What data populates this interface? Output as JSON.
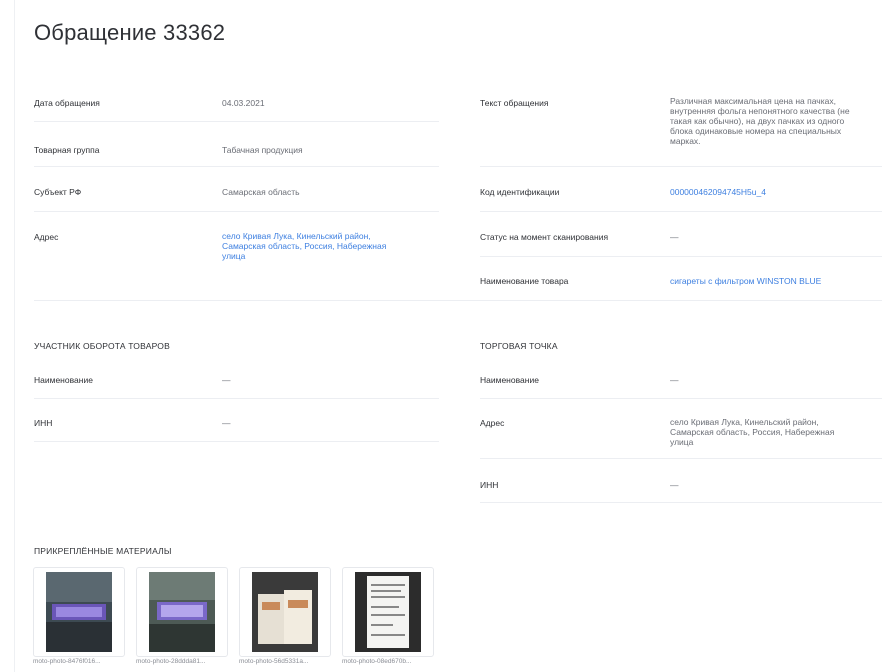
{
  "page": {
    "title": "Обращение 33362"
  },
  "left": {
    "date_label": "Дата обращения",
    "date_value": "04.03.2021",
    "group_label": "Товарная группа",
    "group_value": "Табачная продукция",
    "region_label": "Субъект РФ",
    "region_value": "Самарская область",
    "address_label": "Адрес",
    "address_line1": "село Кривая Лука, Кинельский район,",
    "address_line2": "Самарская область, Россия, Набережная",
    "address_line3": "улица"
  },
  "right": {
    "text_label": "Текст обращения",
    "text_line1": "Различная максимальная цена на пачках,",
    "text_line2": "внутренняя фольга непонятного качества (не",
    "text_line3": "такая как обычно), на двух пачках из одного",
    "text_line4": "блока одинаковые номера на специальных",
    "text_line5": "марках.",
    "code_label": "Код идентификации",
    "code_value": "000000462094745H5u_4",
    "status_label": "Статус на момент сканирования",
    "status_value": "—",
    "product_label": "Наименование товара",
    "product_value": "сигареты с фильтром WINSTON BLUE"
  },
  "participant": {
    "heading": "УЧАСТНИК ОБОРОТА ТОВАРОВ",
    "name_label": "Наименование",
    "name_value": "—",
    "inn_label": "ИНН",
    "inn_value": "—"
  },
  "outlet": {
    "heading": "ТОРГОВАЯ ТОЧКА",
    "name_label": "Наименование",
    "name_value": "—",
    "address_label": "Адрес",
    "address_line1": "село Кривая Лука, Кинельский район,",
    "address_line2": "Самарская область, Россия, Набережная",
    "address_line3": "улица",
    "inn_label": "ИНН",
    "inn_value": "—"
  },
  "attachments": {
    "heading": "ПРИКРЕПЛЁННЫЕ МАТЕРИАЛЫ",
    "files": [
      {
        "name": "moto-photo-8476f016..."
      },
      {
        "name": "moto-photo-28ddda81..."
      },
      {
        "name": "moto-photo-56d5331a..."
      },
      {
        "name": "moto-photo-08ed670b..."
      }
    ]
  }
}
